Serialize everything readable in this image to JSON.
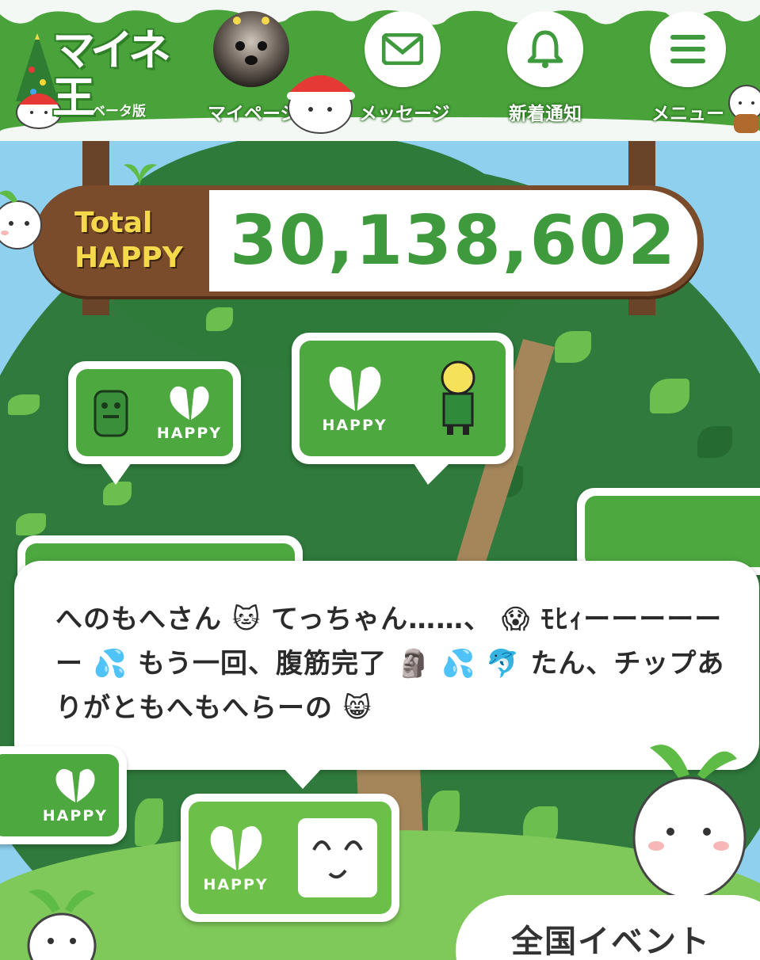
{
  "header": {
    "logo_text": "マイネ王",
    "logo_beta": "ベータ版",
    "nav": [
      {
        "label": "マイページ",
        "icon": "avatar"
      },
      {
        "label": "メッセージ",
        "icon": "envelope-icon"
      },
      {
        "label": "新着通知",
        "icon": "bell-icon"
      },
      {
        "label": "メニュー",
        "icon": "hamburger-menu-icon"
      }
    ]
  },
  "total_happy": {
    "label_line1": "Total",
    "label_line2": "HAPPY",
    "value": "30,138,602"
  },
  "happy_badge_text": "HAPPY",
  "popup": {
    "message": "へのもへさん 🐱 てっちゃん……、 😱 ﾓﾋｨーーーーーー 💦 もう一回、腹筋完了 🗿 💦 🐬 たん、チップありがともへもへらーの 😸"
  },
  "event_button": {
    "label": "全国イベント"
  },
  "colors": {
    "brand_green": "#49a33a",
    "happy_value_green": "#3e9a3d",
    "sign_brown": "#7a4c2c",
    "sign_label_yellow": "#f5d94b"
  }
}
